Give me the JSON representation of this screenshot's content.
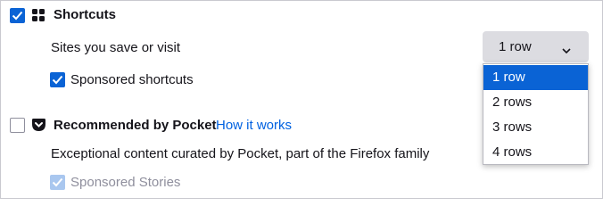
{
  "shortcuts": {
    "checked": true,
    "title": "Shortcuts",
    "rows_label": "Sites you save or visit",
    "rows_select": {
      "selected": "1 row",
      "options": [
        "1 row",
        "2 rows",
        "3 rows",
        "4 rows"
      ],
      "expanded": true
    },
    "sponsored": {
      "checked": true,
      "label": "Sponsored shortcuts"
    }
  },
  "pocket": {
    "checked": false,
    "title": "Recommended by Pocket",
    "link": "How it works",
    "description": "Exceptional content curated by Pocket, part of the Firefox family",
    "sponsored": {
      "checked": true,
      "disabled": true,
      "label": "Sponsored Stories"
    }
  },
  "colors": {
    "accent": "#0a63d5",
    "link": "#0061e0",
    "muted": "#8f8f9d"
  }
}
